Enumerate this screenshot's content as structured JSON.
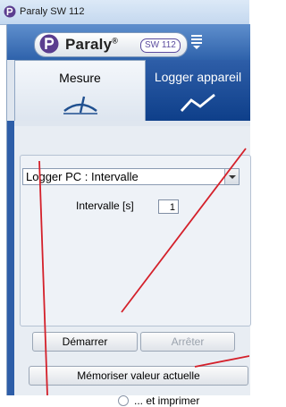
{
  "window": {
    "title": "Paraly SW 112"
  },
  "logo": {
    "brand": "Paraly",
    "reg": "®",
    "model": "SW 112"
  },
  "tabs": [
    {
      "label": "Mesure",
      "icon": "gauge-icon",
      "active": true
    },
    {
      "label": "Logger appareil",
      "icon": "line-chart-icon",
      "active": false
    }
  ],
  "logger": {
    "mode_value": "Logger PC : Intervalle",
    "interval_label": "Intervalle [s]",
    "interval_value": "1"
  },
  "buttons": {
    "start": "Démarrer",
    "stop": "Arrêter",
    "memorize": "Mémoriser valeur actuelle"
  },
  "print_checkbox": {
    "label": "... et imprimer",
    "checked": false
  },
  "colors": {
    "accent": "#2e5ea8",
    "annotation": "#d4202a"
  }
}
